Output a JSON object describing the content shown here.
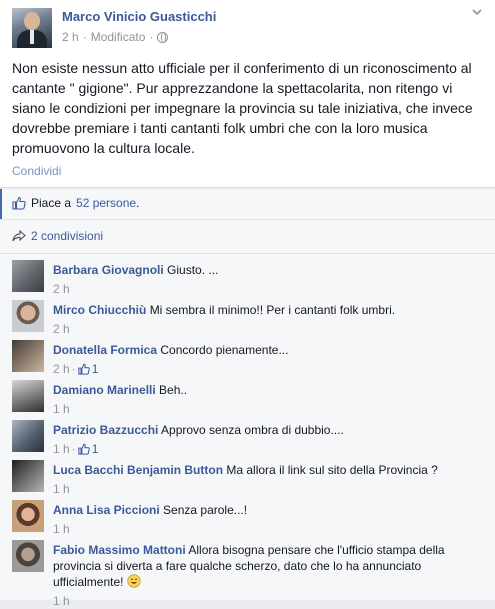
{
  "post": {
    "author": "Marco Vinicio Guasticchi",
    "time": "2 h",
    "separator": "·",
    "edited": "Modificato",
    "text": "Non esiste nessun atto ufficiale per il conferimento di un riconoscimento al cantante \" gigione\". Pur apprezzandone la spettacolarita, non ritengo vi siano le condizioni per impegnare la provincia su tale iniziativa, che invece dovrebbe premiare i tanti cantanti folk umbri che con la loro musica promuovono la cultura locale.",
    "share_label": "Condividi",
    "icons": {
      "visibility": "globe-icon",
      "options": "chevron-down-icon"
    }
  },
  "likes": {
    "prefix": "Piace a",
    "link": "52 persone",
    "suffix": "."
  },
  "shares": {
    "label": "2 condivisioni"
  },
  "comments": [
    {
      "name": "Barbara Giovagnoli",
      "text": "Giusto. ...",
      "time": "2 h",
      "likes": ""
    },
    {
      "name": "Mirco Chiucchiù",
      "text": "Mi sembra il minimo!! Per i cantanti folk umbri.",
      "time": "2 h",
      "likes": ""
    },
    {
      "name": "Donatella Formica",
      "text": "Concordo pienamente...",
      "time": "2 h",
      "likes": "1"
    },
    {
      "name": "Damiano Marinelli",
      "text": "Beh..",
      "time": "1 h",
      "likes": ""
    },
    {
      "name": "Patrizio Bazzucchi",
      "text": "Approvo senza ombra di dubbio....",
      "time": "1 h",
      "likes": "1"
    },
    {
      "name": "Luca Bacchi Benjamin Button",
      "text": "Ma allora il link sul sito della Provincia ?",
      "time": "1 h",
      "likes": ""
    },
    {
      "name": "Anna Lisa Piccioni",
      "text": "Senza parole...!",
      "time": "1 h",
      "likes": ""
    },
    {
      "name": "Fabio Massimo Mattoni",
      "text": "Allora bisogna pensare che l'ufficio stampa della provincia si diverta a fare qualche scherzo, dato che lo ha annunciato ufficialmente!",
      "time": "1 h",
      "likes": ""
    }
  ],
  "meta_separator": "·",
  "colors": {
    "link": "#3b5998",
    "muted": "#90949c",
    "background": "#f6f7f9",
    "accent_bar": "#4267b2"
  }
}
